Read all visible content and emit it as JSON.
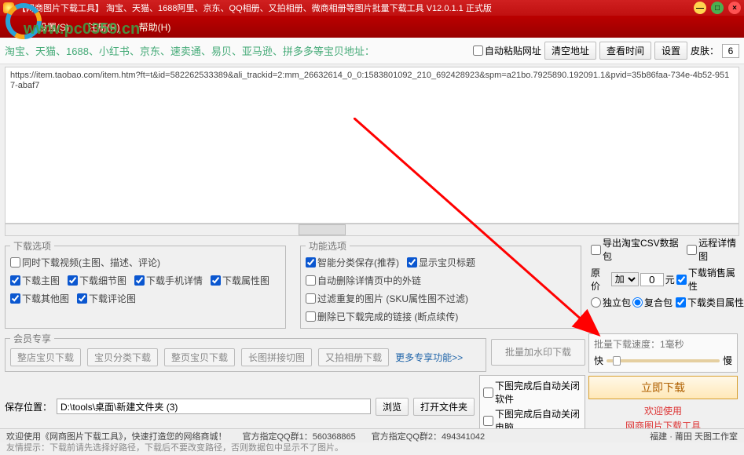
{
  "titlebar": {
    "text": "【网商图片下载工具】 淘宝、天猫、1688阿里、京东、QQ相册、又拍相册、微商相册等图片批量下载工具 V12.0.1.1 正式版"
  },
  "menubar": {
    "m1": "设置(S)",
    "m2": "注册(R)",
    "m3": "帮助(H)"
  },
  "watermark": "www.pc0359.cn",
  "toolbar": {
    "hint": "淘宝、天猫、1688、小红书、京东、速卖通、易贝、亚马逊、拼多多等宝贝地址：",
    "auto_paste": "自动粘贴网址",
    "clear": "清空地址",
    "timer": "查看时间",
    "settings": "设置",
    "skin_label": "皮肤：",
    "skin_value": "6"
  },
  "url_text": "https://item.taobao.com/item.htm?ft=t&id=582262533389&ali_trackid=2:mm_26632614_0_0:1583801092_210_692428923&spm=a21bo.7925890.192091.1&pvid=35b86faa-734e-4b52-9517-abaf7",
  "dl_opts": {
    "legend": "下载选项",
    "video": "同时下载视频(主图、描述、评论)",
    "o1": "下载主图",
    "o2": "下载细节图",
    "o3": "下载手机详情",
    "o4": "下载属性图",
    "o5": "下载其他图",
    "o6": "下载评论图"
  },
  "fn_opts": {
    "legend": "功能选项",
    "f1": "智能分类保存(推荐)",
    "f2": "显示宝贝标题",
    "f3": "自动删除详情页中的外链",
    "f4": "过滤重复的图片 (SKU属性图不过滤)",
    "f5": "删除已下载完成的链接 (断点续传)"
  },
  "right": {
    "csv": "导出淘宝CSV数据包",
    "proc": "远程详情图",
    "price_label": "原价",
    "price_op": "加",
    "price_val": "0",
    "price_unit": "元",
    "sale": "下载销售属性",
    "pack_a": "独立包",
    "pack_b": "复合包",
    "cat": "下载类目属性"
  },
  "member": {
    "legend": "会员专享",
    "b1": "整店宝贝下载",
    "b2": "宝贝分类下载",
    "b3": "整页宝贝下载",
    "b4": "长图拼接切图",
    "b5": "又拍相册下载",
    "more": "更多专享功能>>"
  },
  "batch": {
    "legend": "批量下载速度：1毫秒",
    "watermark_btn": "批量加水印下载",
    "fast": "快",
    "slow": "慢",
    "big_btn": "立即下载",
    "welcome1": "欢迎使用",
    "welcome2": "网商图片下载工具",
    "after1": "下图完成后自动关闭软件",
    "after2": "下图完成后自动关闭电脑"
  },
  "save": {
    "label": "保存位置：",
    "path": "D:\\tools\\桌面\\新建文件夹 (3)",
    "browse": "浏览",
    "open": "打开文件夹"
  },
  "tip": "友情提示：下载前请先选择好路径，下载后不要改变路径，否则数据包中显示不了图片。",
  "status": {
    "s1": "欢迎使用《网商图片下载工具》，快速打造您的网络商城！",
    "s2": "官方指定QQ群1：560368865",
    "s3": "官方指定QQ群2：494341042",
    "s4": "福建 · 莆田 天图工作室"
  }
}
